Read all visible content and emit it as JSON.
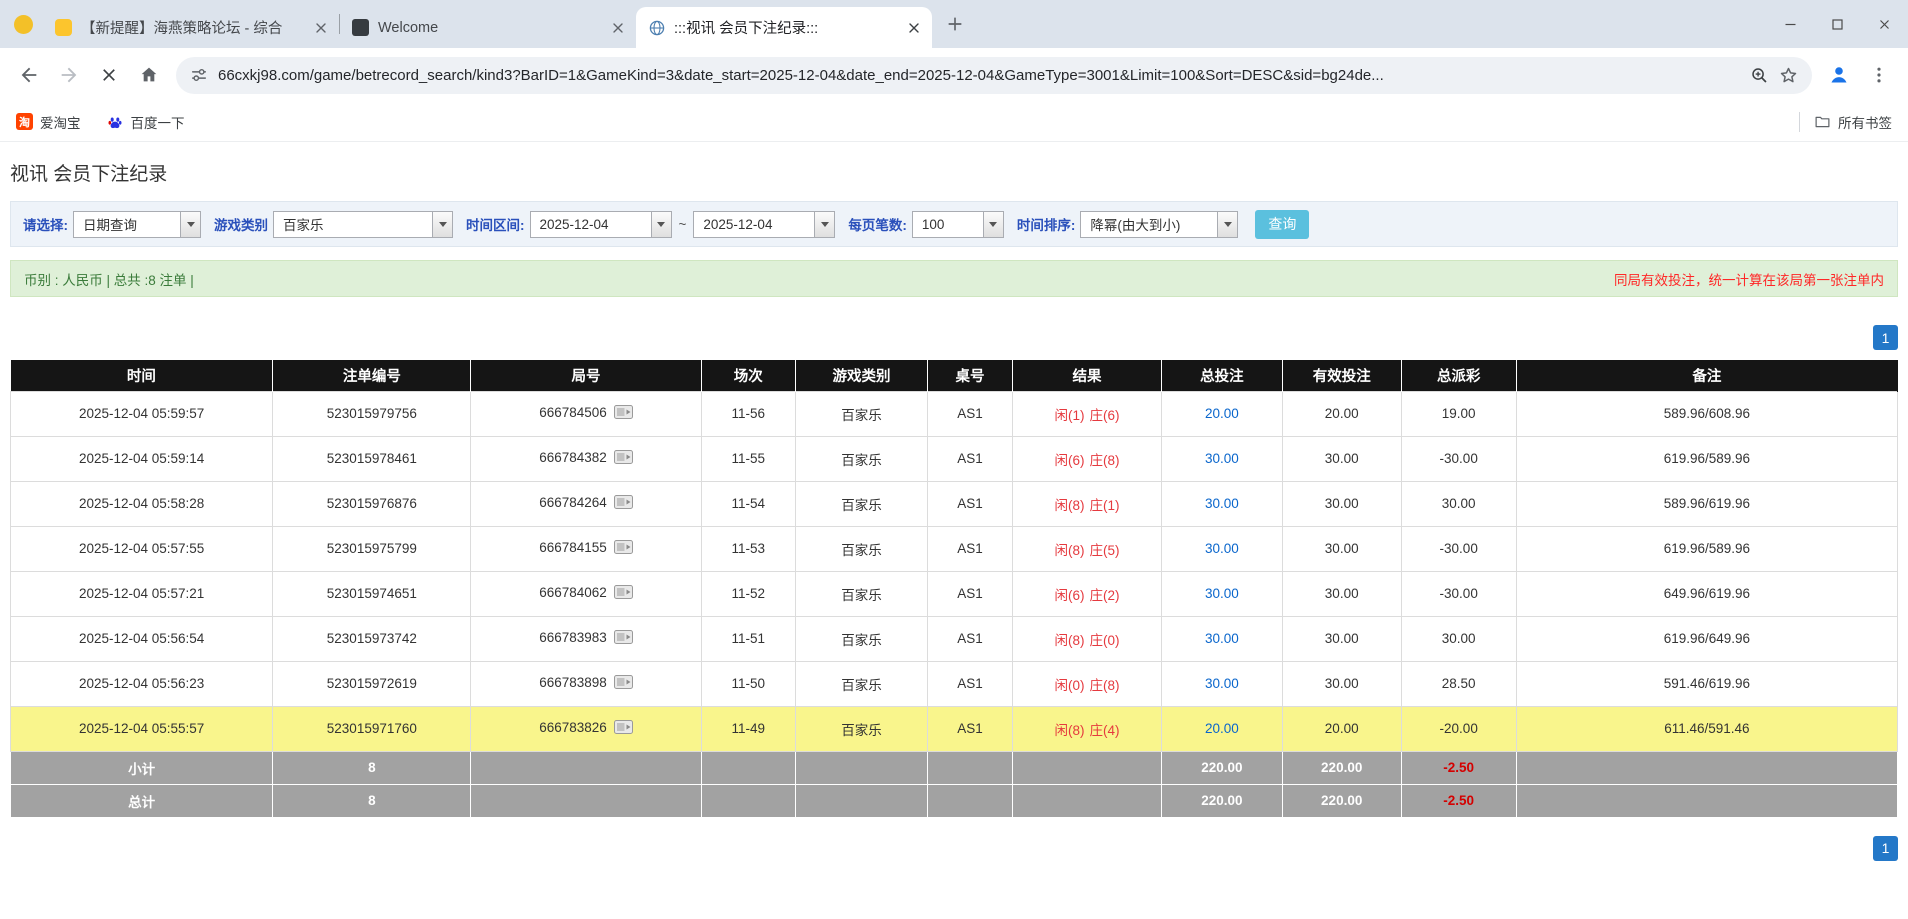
{
  "colors": {
    "accent_blue": "#0a66cc",
    "negative_red": "#e60000",
    "result_red": "#e5393e",
    "highlight_yellow": "#f9f58c",
    "pager_blue": "#2478c8",
    "summary_green_bg": "#dff0d8",
    "warning_red": "#ff2727",
    "search_button_blue": "#5bc0de",
    "table_header_bg": "#151515",
    "sum_row_gray": "#a2a2a2"
  },
  "browser": {
    "tabs": [
      {
        "title": "【新提醒】海燕策略论坛 - 综合",
        "active": false
      },
      {
        "title": "Welcome",
        "active": false
      },
      {
        "title": ":::视讯 会员下注纪录:::",
        "active": true
      }
    ],
    "url": "66cxkj98.com/game/betrecord_search/kind3?BarID=1&GameKind=3&date_start=2025-12-04&date_end=2025-12-04&GameType=3001&Limit=100&Sort=DESC&sid=bg24de...",
    "bookmarks": [
      {
        "label": "爱淘宝",
        "icon_text": "淘"
      },
      {
        "label": "百度一下"
      }
    ],
    "all_bookmarks_label": "所有书签"
  },
  "page": {
    "title": "视讯 会员下注纪录",
    "filters": {
      "select_label": "请选择:",
      "select_value": "日期查询",
      "game_type_label": "游戏类别",
      "game_type_value": "百家乐",
      "date_range_label": "时间区间:",
      "date_start": "2025-12-04",
      "date_separator": "~",
      "date_end": "2025-12-04",
      "page_size_label": "每页笔数:",
      "page_size_value": "100",
      "sort_label": "时间排序:",
      "sort_value": "降幂(由大到小)",
      "search_button": "查询"
    },
    "summary": {
      "currency_info": "币别 : 人民币 | 总共 :8 注单 |",
      "note": "同局有效投注，统一计算在该局第一张注单内"
    },
    "pagination": {
      "current_page": "1"
    },
    "table": {
      "headers": [
        "时间",
        "注单编号",
        "局号",
        "场次",
        "游戏类别",
        "桌号",
        "结果",
        "总投注",
        "有效投注",
        "总派彩",
        "备注"
      ],
      "rows": [
        {
          "time": "2025-12-04 05:59:57",
          "bet_id": "523015979756",
          "round": "666784506",
          "session": "11-56",
          "game": "百家乐",
          "table_no": "AS1",
          "result_player": "闲(1)",
          "result_banker": "庄(6)",
          "total_bet": "20.00",
          "valid_bet": "20.00",
          "payout": "19.00",
          "note": "589.96/608.96",
          "highlight": false
        },
        {
          "time": "2025-12-04 05:59:14",
          "bet_id": "523015978461",
          "round": "666784382",
          "session": "11-55",
          "game": "百家乐",
          "table_no": "AS1",
          "result_player": "闲(6)",
          "result_banker": "庄(8)",
          "total_bet": "30.00",
          "valid_bet": "30.00",
          "payout": "-30.00",
          "note": "619.96/589.96",
          "highlight": false
        },
        {
          "time": "2025-12-04 05:58:28",
          "bet_id": "523015976876",
          "round": "666784264",
          "session": "11-54",
          "game": "百家乐",
          "table_no": "AS1",
          "result_player": "闲(8)",
          "result_banker": "庄(1)",
          "total_bet": "30.00",
          "valid_bet": "30.00",
          "payout": "30.00",
          "note": "589.96/619.96",
          "highlight": false
        },
        {
          "time": "2025-12-04 05:57:55",
          "bet_id": "523015975799",
          "round": "666784155",
          "session": "11-53",
          "game": "百家乐",
          "table_no": "AS1",
          "result_player": "闲(8)",
          "result_banker": "庄(5)",
          "total_bet": "30.00",
          "valid_bet": "30.00",
          "payout": "-30.00",
          "note": "619.96/589.96",
          "highlight": false
        },
        {
          "time": "2025-12-04 05:57:21",
          "bet_id": "523015974651",
          "round": "666784062",
          "session": "11-52",
          "game": "百家乐",
          "table_no": "AS1",
          "result_player": "闲(6)",
          "result_banker": "庄(2)",
          "total_bet": "30.00",
          "valid_bet": "30.00",
          "payout": "-30.00",
          "note": "649.96/619.96",
          "highlight": false
        },
        {
          "time": "2025-12-04 05:56:54",
          "bet_id": "523015973742",
          "round": "666783983",
          "session": "11-51",
          "game": "百家乐",
          "table_no": "AS1",
          "result_player": "闲(8)",
          "result_banker": "庄(0)",
          "total_bet": "30.00",
          "valid_bet": "30.00",
          "payout": "30.00",
          "note": "619.96/649.96",
          "highlight": false
        },
        {
          "time": "2025-12-04 05:56:23",
          "bet_id": "523015972619",
          "round": "666783898",
          "session": "11-50",
          "game": "百家乐",
          "table_no": "AS1",
          "result_player": "闲(0)",
          "result_banker": "庄(8)",
          "total_bet": "30.00",
          "valid_bet": "30.00",
          "payout": "28.50",
          "note": "591.46/619.96",
          "highlight": false
        },
        {
          "time": "2025-12-04 05:55:57",
          "bet_id": "523015971760",
          "round": "666783826",
          "session": "11-49",
          "game": "百家乐",
          "table_no": "AS1",
          "result_player": "闲(8)",
          "result_banker": "庄(4)",
          "total_bet": "20.00",
          "valid_bet": "20.00",
          "payout": "-20.00",
          "note": "611.46/591.46",
          "highlight": true
        }
      ],
      "subtotal": {
        "label": "小计",
        "count": "8",
        "total_bet": "220.00",
        "valid_bet": "220.00",
        "payout": "-2.50"
      },
      "total": {
        "label": "总计",
        "count": "8",
        "total_bet": "220.00",
        "valid_bet": "220.00",
        "payout": "-2.50"
      }
    }
  }
}
